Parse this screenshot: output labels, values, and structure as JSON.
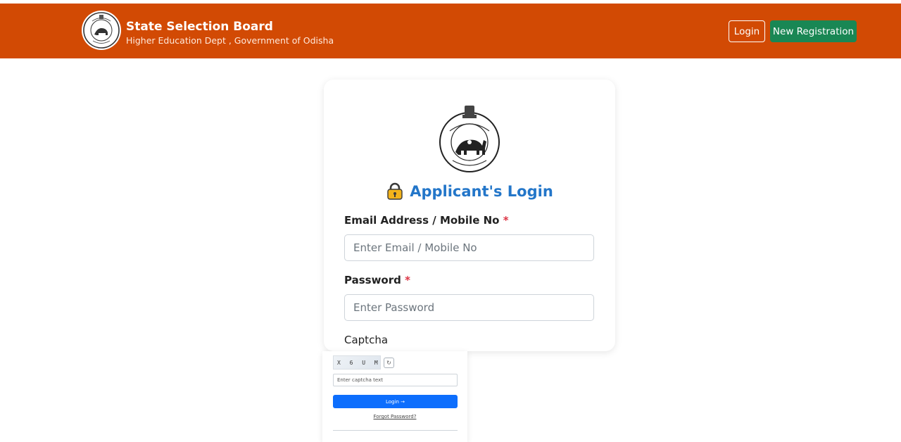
{
  "navbar": {
    "title": "State Selection Board",
    "subtitle": "Higher Education Dept , Government of Odisha",
    "login_label": "Login",
    "register_label": "New Registration",
    "bg_color": "#d24a04",
    "register_color": "#198754"
  },
  "card": {
    "heading": "Applicant's Login",
    "heading_color": "#2376c9",
    "email_label": "Email Address / Mobile No",
    "email_placeholder": "Enter Email / Mobile No",
    "password_label": "Password",
    "password_placeholder": "Enter Password",
    "required_mark": "*",
    "captcha_label": "Captcha"
  },
  "captcha": {
    "image_text": "X 6 U M C",
    "refresh_icon": "↻",
    "input_placeholder": "Enter captcha text",
    "login_button": "Login →",
    "login_button_color": "#0d6efd",
    "forgot_link": "Forgot Password?"
  },
  "icons": {
    "emblem": "odisha-emblem-icon",
    "lock": "lock-icon",
    "refresh": "refresh-icon"
  }
}
